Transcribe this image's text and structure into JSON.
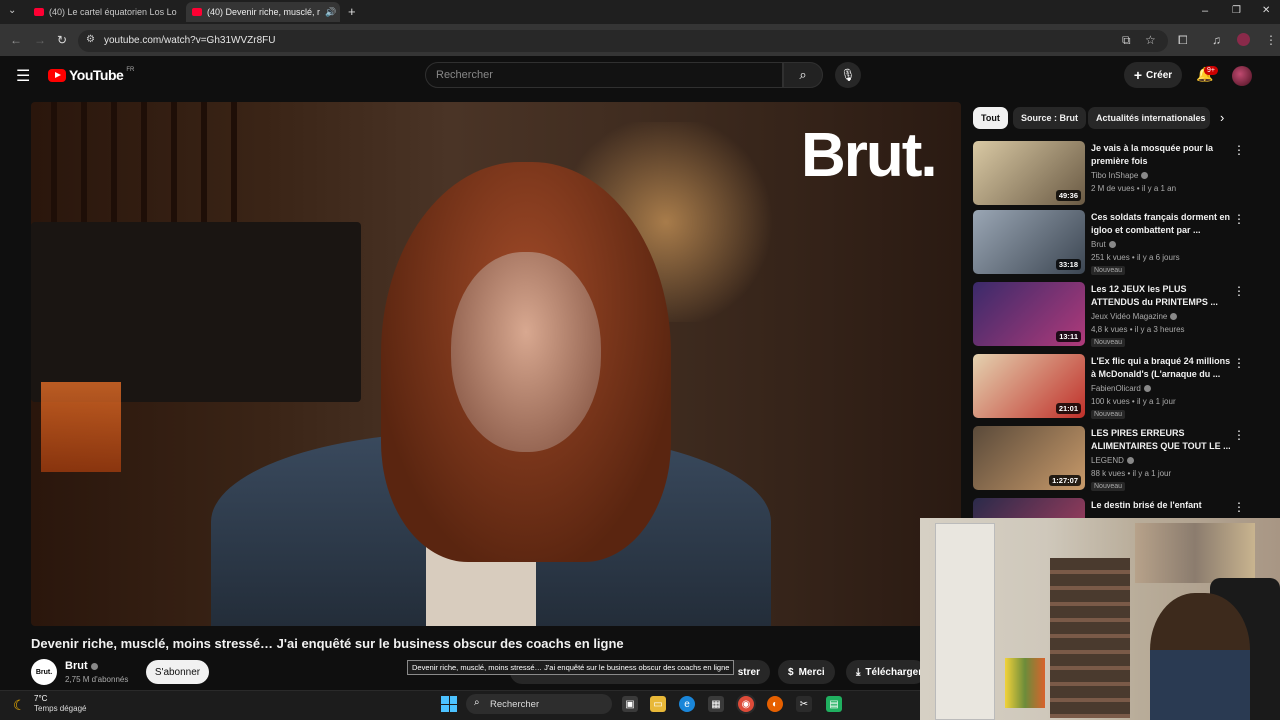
{
  "browser": {
    "tabs": [
      {
        "label": "(40) Le cartel équatorien Los Lo"
      },
      {
        "label": "(40) Devenir riche, musclé, r"
      }
    ],
    "url": "youtube.com/watch?v=Gh31WVZr8FU"
  },
  "youtube": {
    "logo_text": "YouTube",
    "region": "FR",
    "search_placeholder": "Rechercher",
    "create_label": "Créer",
    "notification_count": "9+"
  },
  "video": {
    "overlay_brand": "Brut.",
    "title": "Devenir riche, musclé, moins stressé… J'ai enquêté sur le business obscur des coachs en ligne",
    "tooltip": "Devenir riche, musclé, moins stressé… J'ai enquêté sur le business obscur des coachs en ligne",
    "channel": {
      "avatar_text": "Brut.",
      "name": "Brut",
      "subscribers": "2,75 M d'abonnés"
    },
    "subscribe_label": "S'abonner",
    "actions": {
      "share_partial": "strer",
      "thanks": "Merci",
      "download": "Télécharger"
    }
  },
  "sidebar": {
    "chips": [
      {
        "label": "Tout",
        "selected": true
      },
      {
        "label": "Source : Brut",
        "selected": false
      },
      {
        "label": "Actualités internationales",
        "selected": false
      }
    ],
    "recommendations": [
      {
        "title": "Je vais à la mosquée pour la première fois",
        "channel": "Tibo InShape",
        "meta": "2 M de vues • il y a 1 an",
        "duration": "49:36",
        "new": "",
        "thumb_colors": [
          "#d9c9a4",
          "#6a5a44"
        ]
      },
      {
        "title": "Ces soldats français dorment en igloo et combattent par ...",
        "channel": "Brut",
        "meta": "251 k vues • il y a 6 jours",
        "duration": "33:18",
        "new": "Nouveau",
        "thumb_colors": [
          "#9aa6b4",
          "#3c4652"
        ]
      },
      {
        "title": "Les 12 JEUX les PLUS ATTENDUS du PRINTEMPS ...",
        "channel": "Jeux Vidéo Magazine",
        "meta": "4,8 k vues • il y a 3 heures",
        "duration": "13:11",
        "new": "Nouveau",
        "thumb_colors": [
          "#3a2a6a",
          "#b03a7a"
        ]
      },
      {
        "title": "L'Ex flic qui a braqué 24 millions à McDonald's (L'arnaque du ...",
        "channel": "FabienOlicard",
        "meta": "100 k vues • il y a 1 jour",
        "duration": "21:01",
        "new": "Nouveau",
        "thumb_colors": [
          "#e4d2b0",
          "#c0302a"
        ]
      },
      {
        "title": "LES PIRES ERREURS ALIMENTAIRES QUE TOUT LE ...",
        "channel": "LEGEND",
        "meta": "88 k vues • il y a 1 jour",
        "duration": "1:27:07",
        "new": "Nouveau",
        "thumb_colors": [
          "#5a4a3a",
          "#c89a6a"
        ]
      },
      {
        "title": "Le destin brisé de l'enfant",
        "channel": "",
        "meta": "",
        "duration": "",
        "new": "",
        "thumb_colors": [
          "#2a2a4a",
          "#b04060"
        ]
      }
    ]
  },
  "taskbar": {
    "temperature": "7°C",
    "weather": "Temps dégagé",
    "search_label": "Rechercher"
  }
}
